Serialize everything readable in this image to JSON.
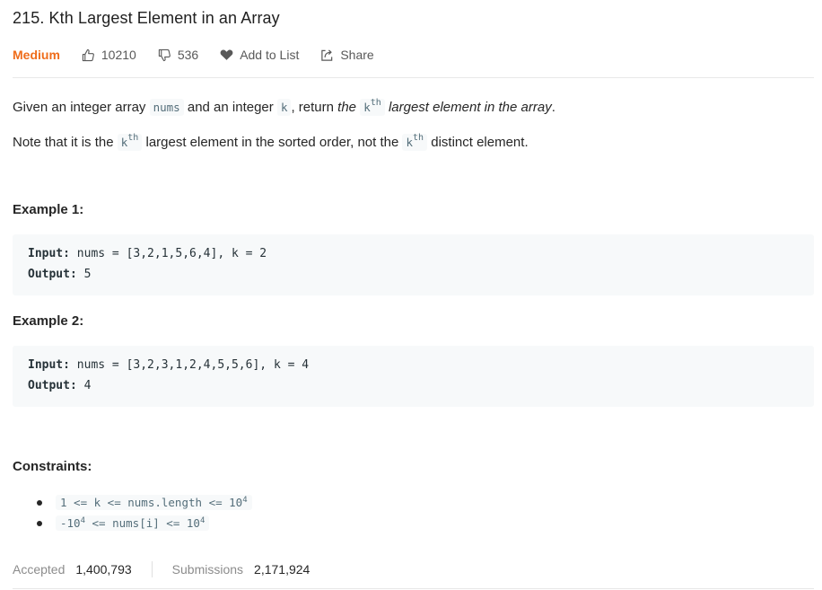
{
  "problem": {
    "title": "215. Kth Largest Element in an Array",
    "difficulty": "Medium",
    "likes": "10210",
    "dislikes": "536",
    "add_to_list": "Add to List",
    "share": "Share",
    "accent_color": "#ef6c1a"
  },
  "description": {
    "p1": {
      "t1": "Given an integer array ",
      "code1": "nums",
      "t2": " and an integer ",
      "code2": "k",
      "t3": ", return ",
      "em1": "the",
      "code3": "k",
      "sup3": "th",
      "em2": "largest element in the array",
      "t4": "."
    },
    "p2": {
      "t1": "Note that it is the ",
      "code1": "k",
      "sup1": "th",
      "t2": " largest element in the sorted order, not the ",
      "code2": "k",
      "sup2": "th",
      "t3": " distinct element."
    }
  },
  "examples": [
    {
      "heading": "Example 1:",
      "input_label": "Input:",
      "input_value": " nums = [3,2,1,5,6,4], k = 2",
      "output_label": "Output:",
      "output_value": " 5"
    },
    {
      "heading": "Example 2:",
      "input_label": "Input:",
      "input_value": " nums = [3,2,3,1,2,4,5,5,6], k = 4",
      "output_label": "Output:",
      "output_value": " 4"
    }
  ],
  "constraints": {
    "heading": "Constraints:",
    "items": [
      {
        "pre": "1 <= k <= nums.length <= 10",
        "sup": "4",
        "post": ""
      },
      {
        "pre": "-10",
        "sup": "4",
        "post": " <= nums[i] <= 10",
        "sup2": "4"
      }
    ]
  },
  "stats": {
    "accepted_label": "Accepted",
    "accepted_value": "1,400,793",
    "submissions_label": "Submissions",
    "submissions_value": "2,171,924"
  }
}
